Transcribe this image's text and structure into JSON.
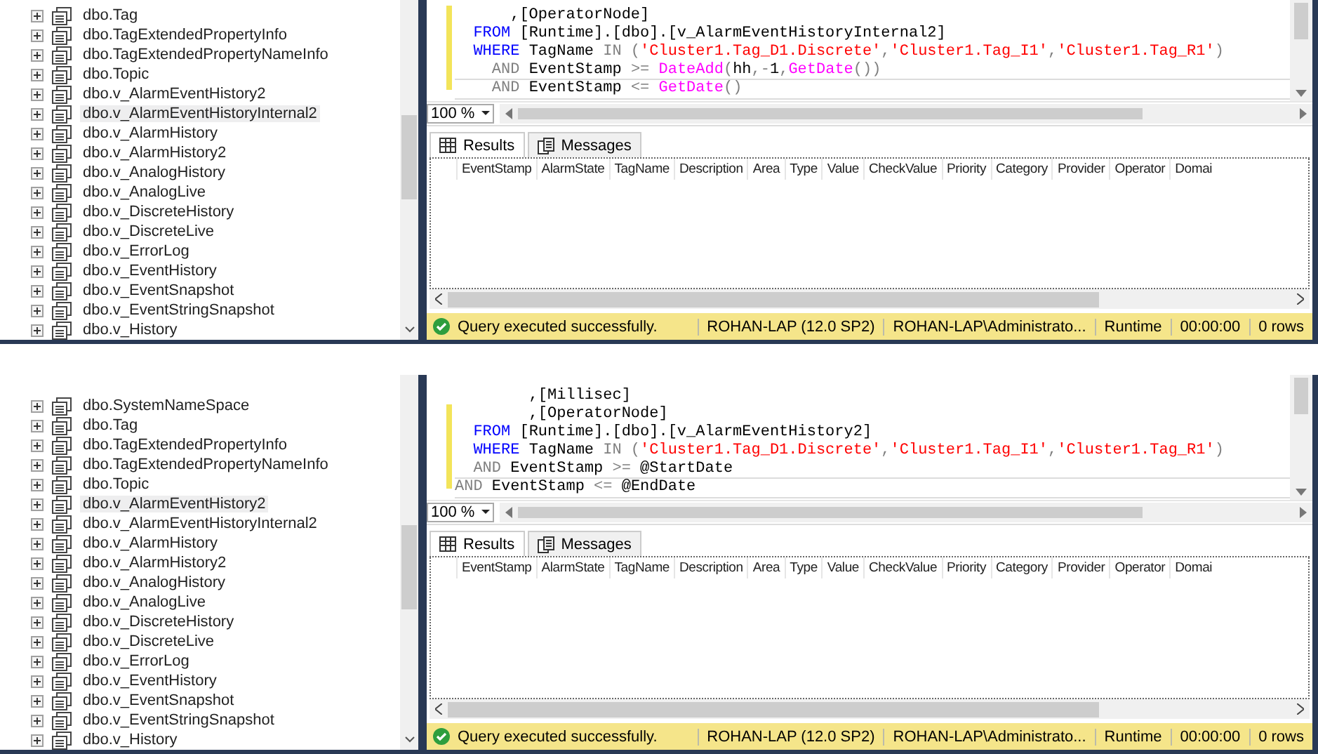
{
  "screens": [
    {
      "tree": {
        "items": [
          {
            "label": "dbo.Tag",
            "selected": false
          },
          {
            "label": "dbo.TagExtendedPropertyInfo",
            "selected": false
          },
          {
            "label": "dbo.TagExtendedPropertyNameInfo",
            "selected": false
          },
          {
            "label": "dbo.Topic",
            "selected": false
          },
          {
            "label": "dbo.v_AlarmEventHistory2",
            "selected": false
          },
          {
            "label": "dbo.v_AlarmEventHistoryInternal2",
            "selected": true
          },
          {
            "label": "dbo.v_AlarmHistory",
            "selected": false
          },
          {
            "label": "dbo.v_AlarmHistory2",
            "selected": false
          },
          {
            "label": "dbo.v_AnalogHistory",
            "selected": false
          },
          {
            "label": "dbo.v_AnalogLive",
            "selected": false
          },
          {
            "label": "dbo.v_DiscreteHistory",
            "selected": false
          },
          {
            "label": "dbo.v_DiscreteLive",
            "selected": false
          },
          {
            "label": "dbo.v_ErrorLog",
            "selected": false
          },
          {
            "label": "dbo.v_EventHistory",
            "selected": false
          },
          {
            "label": "dbo.v_EventSnapshot",
            "selected": false
          },
          {
            "label": "dbo.v_EventStringSnapshot",
            "selected": false
          },
          {
            "label": "dbo.v_History",
            "selected": false
          }
        ]
      },
      "editor": {
        "lines": [
          {
            "current": false,
            "tokens": [
              {
                "kind": "text",
                "text": "      ,[OperatorNode]"
              }
            ]
          },
          {
            "current": false,
            "tokens": [
              {
                "kind": "keyword",
                "text": "  FROM "
              },
              {
                "kind": "text",
                "text": "[Runtime].[dbo].[v_AlarmEventHistoryInternal2]"
              }
            ]
          },
          {
            "current": false,
            "tokens": [
              {
                "kind": "keyword",
                "text": "  WHERE "
              },
              {
                "kind": "text",
                "text": "TagName "
              },
              {
                "kind": "op",
                "text": "IN ("
              },
              {
                "kind": "string",
                "text": "'Cluster1.Tag_D1.Discrete'"
              },
              {
                "kind": "op",
                "text": ","
              },
              {
                "kind": "string",
                "text": "'Cluster1.Tag_I1'"
              },
              {
                "kind": "op",
                "text": ","
              },
              {
                "kind": "string",
                "text": "'Cluster1.Tag_R1'"
              },
              {
                "kind": "op",
                "text": ")"
              }
            ]
          },
          {
            "current": false,
            "tokens": [
              {
                "kind": "op",
                "text": "    AND "
              },
              {
                "kind": "text",
                "text": "EventStamp "
              },
              {
                "kind": "op",
                "text": ">= "
              },
              {
                "kind": "func",
                "text": "DateAdd"
              },
              {
                "kind": "op",
                "text": "("
              },
              {
                "kind": "text",
                "text": "hh"
              },
              {
                "kind": "op",
                "text": ",-"
              },
              {
                "kind": "text",
                "text": "1"
              },
              {
                "kind": "op",
                "text": ","
              },
              {
                "kind": "func",
                "text": "GetDate"
              },
              {
                "kind": "op",
                "text": "())"
              }
            ]
          },
          {
            "current": true,
            "tokens": [
              {
                "kind": "op",
                "text": "    AND "
              },
              {
                "kind": "text",
                "text": "EventStamp "
              },
              {
                "kind": "op",
                "text": "<= "
              },
              {
                "kind": "func",
                "text": "GetDate"
              },
              {
                "kind": "op",
                "text": "()"
              }
            ]
          }
        ]
      },
      "zoom": "100 %",
      "results": {
        "tabs": [
          {
            "label": "Results",
            "selected": true
          },
          {
            "label": "Messages",
            "selected": false
          }
        ],
        "columns": [
          "EventStamp",
          "AlarmState",
          "TagName",
          "Description",
          "Area",
          "Type",
          "Value",
          "CheckValue",
          "Priority",
          "Category",
          "Provider",
          "Operator",
          "Domai"
        ]
      },
      "status": {
        "message": "Query executed successfully.",
        "server": "ROHAN-LAP (12.0 SP2)",
        "user": "ROHAN-LAP\\Administrato...",
        "database": "Runtime",
        "time": "00:00:00",
        "rows": "0 rows"
      }
    },
    {
      "tree": {
        "items": [
          {
            "label": "dbo.SystemNameSpace",
            "selected": false
          },
          {
            "label": "dbo.Tag",
            "selected": false
          },
          {
            "label": "dbo.TagExtendedPropertyInfo",
            "selected": false
          },
          {
            "label": "dbo.TagExtendedPropertyNameInfo",
            "selected": false
          },
          {
            "label": "dbo.Topic",
            "selected": false
          },
          {
            "label": "dbo.v_AlarmEventHistory2",
            "selected": true
          },
          {
            "label": "dbo.v_AlarmEventHistoryInternal2",
            "selected": false
          },
          {
            "label": "dbo.v_AlarmHistory",
            "selected": false
          },
          {
            "label": "dbo.v_AlarmHistory2",
            "selected": false
          },
          {
            "label": "dbo.v_AnalogHistory",
            "selected": false
          },
          {
            "label": "dbo.v_AnalogLive",
            "selected": false
          },
          {
            "label": "dbo.v_DiscreteHistory",
            "selected": false
          },
          {
            "label": "dbo.v_DiscreteLive",
            "selected": false
          },
          {
            "label": "dbo.v_ErrorLog",
            "selected": false
          },
          {
            "label": "dbo.v_EventHistory",
            "selected": false
          },
          {
            "label": "dbo.v_EventSnapshot",
            "selected": false
          },
          {
            "label": "dbo.v_EventStringSnapshot",
            "selected": false
          },
          {
            "label": "dbo.v_History",
            "selected": false
          }
        ]
      },
      "editor": {
        "lines": [
          {
            "current": false,
            "tokens": [
              {
                "kind": "text",
                "text": "        ,[Millisec]"
              }
            ]
          },
          {
            "current": false,
            "tokens": [
              {
                "kind": "text",
                "text": "        ,[OperatorNode]"
              }
            ]
          },
          {
            "current": false,
            "tokens": [
              {
                "kind": "keyword",
                "text": "  FROM "
              },
              {
                "kind": "text",
                "text": "[Runtime].[dbo].[v_AlarmEventHistory2]"
              }
            ]
          },
          {
            "current": false,
            "tokens": [
              {
                "kind": "keyword",
                "text": "  WHERE "
              },
              {
                "kind": "text",
                "text": "TagName "
              },
              {
                "kind": "op",
                "text": "IN ("
              },
              {
                "kind": "string",
                "text": "'Cluster1.Tag_D1.Discrete'"
              },
              {
                "kind": "op",
                "text": ","
              },
              {
                "kind": "string",
                "text": "'Cluster1.Tag_I1'"
              },
              {
                "kind": "op",
                "text": ","
              },
              {
                "kind": "string",
                "text": "'Cluster1.Tag_R1'"
              },
              {
                "kind": "op",
                "text": ")"
              }
            ]
          },
          {
            "current": false,
            "tokens": [
              {
                "kind": "op",
                "text": "  AND "
              },
              {
                "kind": "text",
                "text": "EventStamp "
              },
              {
                "kind": "op",
                "text": ">= "
              },
              {
                "kind": "text",
                "text": "@StartDate"
              }
            ]
          },
          {
            "current": true,
            "tokens": [
              {
                "kind": "op",
                "text": "AND "
              },
              {
                "kind": "text",
                "text": "EventStamp "
              },
              {
                "kind": "op",
                "text": "<= "
              },
              {
                "kind": "text",
                "text": "@EndDate"
              }
            ]
          }
        ]
      },
      "zoom": "100 %",
      "results": {
        "tabs": [
          {
            "label": "Results",
            "selected": true
          },
          {
            "label": "Messages",
            "selected": false
          }
        ],
        "columns": [
          "EventStamp",
          "AlarmState",
          "TagName",
          "Description",
          "Area",
          "Type",
          "Value",
          "CheckValue",
          "Priority",
          "Category",
          "Provider",
          "Operator",
          "Domai"
        ]
      },
      "status": {
        "message": "Query executed successfully.",
        "server": "ROHAN-LAP (12.0 SP2)",
        "user": "ROHAN-LAP\\Administrato...",
        "database": "Runtime",
        "time": "00:00:00",
        "rows": "0 rows"
      }
    }
  ]
}
